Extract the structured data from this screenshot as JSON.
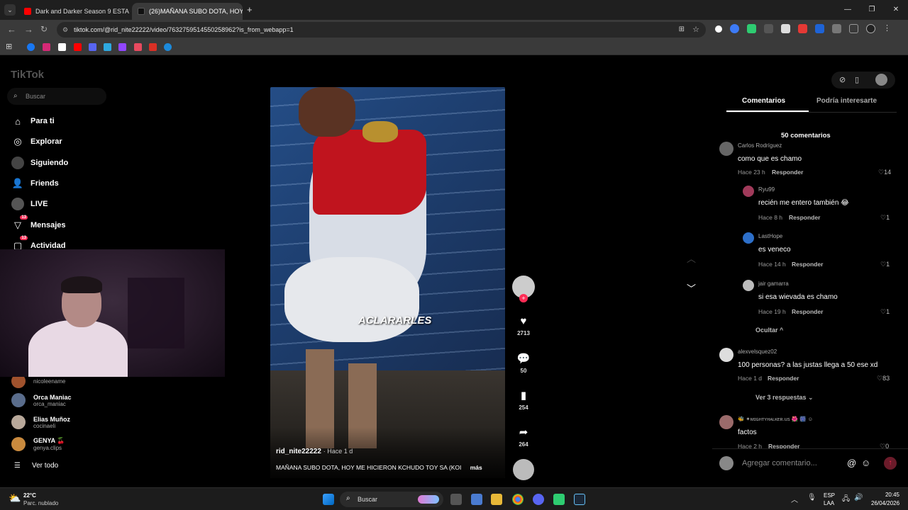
{
  "browser": {
    "tabs": [
      {
        "title": "Dark and Darker Season 9 ESTA",
        "icon": "youtube-icon"
      },
      {
        "title": "(26)MAÑANA SUBO DOTA, HOY",
        "icon": "tiktok-icon"
      }
    ],
    "new_tab": "+",
    "url": "tiktok.com/@rid_nite22222/video/7632759514550258962?is_from_webapp=1"
  },
  "tiktok": {
    "logo": "TikTok",
    "search_placeholder": "Buscar",
    "nav": [
      {
        "label": "Para ti",
        "icon": "home-icon"
      },
      {
        "label": "Explorar",
        "icon": "compass-icon"
      },
      {
        "label": "Siguiendo",
        "icon": "following-icon"
      },
      {
        "label": "Friends",
        "icon": "friends-icon"
      },
      {
        "label": "LIVE",
        "icon": "live-icon"
      },
      {
        "label": "Mensajes",
        "icon": "messages-icon",
        "badge": "13"
      },
      {
        "label": "Actividad",
        "icon": "activity-icon",
        "badge": "13"
      }
    ],
    "following": [
      {
        "handle": "nicoleename"
      },
      {
        "name": "Orca Maniac",
        "handle": "orca_maniac"
      },
      {
        "name": "Elias Muñoz",
        "handle": "cocinaeli"
      },
      {
        "name": "GENYA 🍒",
        "handle": "genya.clips"
      }
    ],
    "see_all": "Ver todo",
    "video": {
      "overlay_text": "ACLARARLES",
      "author": "rid_nite22222",
      "time": "· Hace 1 d",
      "caption": "MAÑANA SUBO DOTA, HOY ME HICIERON KCHUDO TOY SA (KOI",
      "more": "más"
    },
    "actions": {
      "likes": "2713",
      "comments": "50",
      "saves": "254",
      "shares": "264"
    },
    "panel": {
      "tabs": [
        "Comentarios",
        "Podría interesarte"
      ],
      "count": "50 comentarios",
      "comments": [
        {
          "user": "Carlos Rodríguez",
          "text": "como que es chamo",
          "time": "Hace 23 h",
          "reply": "Responder",
          "likes": "14"
        },
        {
          "user": "Ryu99",
          "text": "recién me entero también 😂",
          "time": "Hace 8 h",
          "reply": "Responder",
          "likes": "1"
        },
        {
          "user": "LastHope",
          "text": "es veneco",
          "time": "Hace 14 h",
          "reply": "Responder",
          "likes": "1"
        },
        {
          "user": "jair gamarra",
          "text": "si esa wievada es chamo",
          "time": "Hace 19 h",
          "reply": "Responder",
          "likes": "1"
        },
        {
          "user": "alexvelsquez02",
          "text": "100 personas? a las justas llega a 50 ese xd",
          "time": "Hace 1 d",
          "reply": "Responder",
          "likes": "83"
        },
        {
          "user": "🐝 ✦ᴍɪɢʜᴛʏʜᴀʟᴋᴇʀ.us 🌺 🎆 ☺",
          "text": "factos",
          "time": "Hace 2 h",
          "reply": "Responder",
          "likes": "0"
        }
      ],
      "hide": "Ocultar ^",
      "see_replies": "Ver 3 respuestas ⌄",
      "add_comment_placeholder": "Agregar comentario..."
    }
  },
  "taskbar": {
    "weather_temp": "22°C",
    "weather_desc": "Parc. nublado",
    "search": "Buscar",
    "lang": "ESP",
    "lang2": "LAA",
    "time": "20:45",
    "date": "26/04/2026"
  },
  "colors": {
    "accent": "#fe2c55",
    "bg": "#000000",
    "panel_text": "#ffffff"
  }
}
